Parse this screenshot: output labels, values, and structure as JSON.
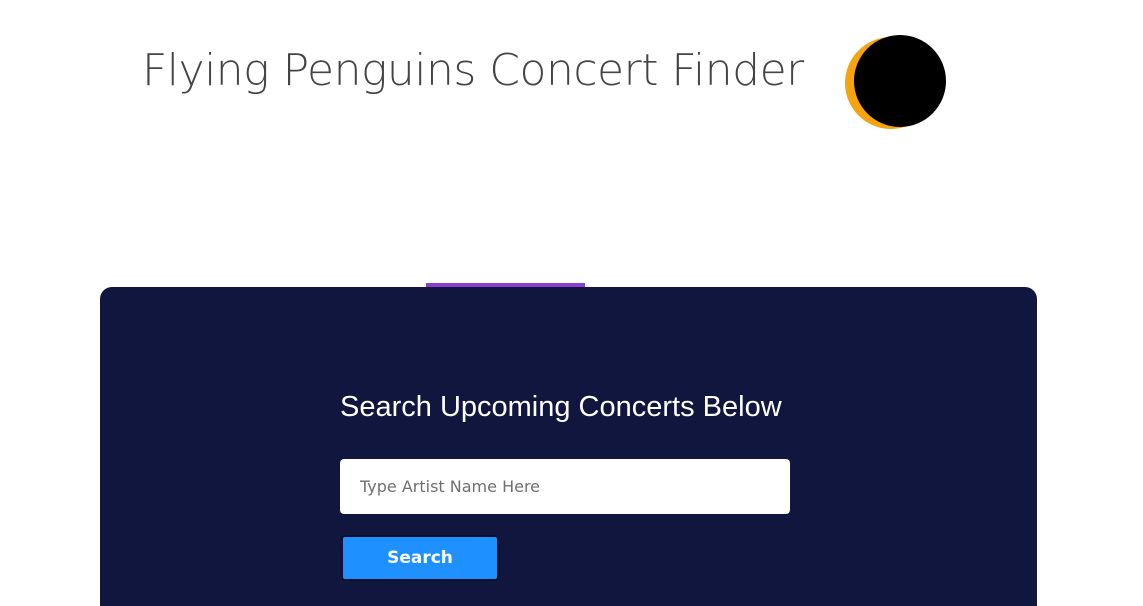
{
  "header": {
    "title": "Flying Penguins Concert Finder",
    "logo_icon": "eclipse-moon-icon",
    "logo_colors": {
      "outer": "#f5a30f",
      "inner": "#000000"
    }
  },
  "search_panel": {
    "accent_color": "#8a3fd1",
    "background_color": "#10163d",
    "heading": "Search Upcoming Concerts Below",
    "input": {
      "placeholder": "Type Artist Name Here",
      "value": ""
    },
    "search_button_label": "Search",
    "button_color": "#1e90ff"
  }
}
